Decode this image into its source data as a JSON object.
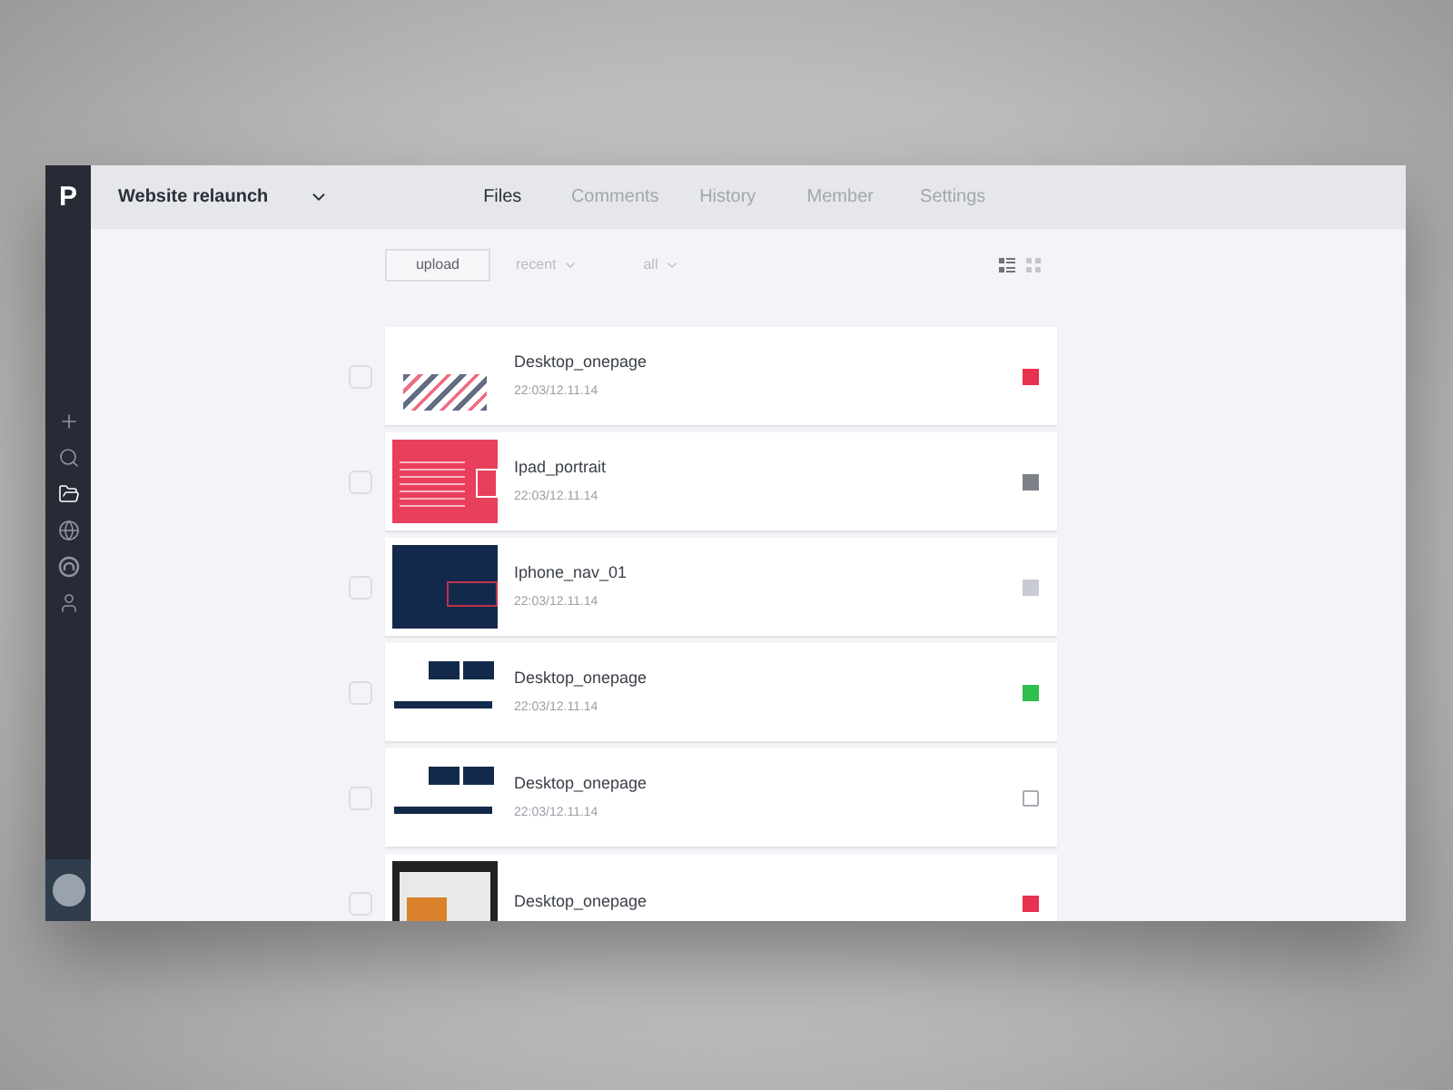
{
  "logo": "P",
  "sidebar": {
    "items": [
      {
        "kind": "plus",
        "selected": false
      },
      {
        "kind": "search",
        "selected": false
      },
      {
        "kind": "folder",
        "selected": true
      },
      {
        "kind": "globe",
        "selected": false
      },
      {
        "kind": "arch",
        "selected": false
      },
      {
        "kind": "user",
        "selected": false
      }
    ]
  },
  "project": {
    "title": "Website relaunch"
  },
  "tabs": [
    {
      "label": "Files",
      "selected": true
    },
    {
      "label": "Comments",
      "selected": false
    },
    {
      "label": "History",
      "selected": false
    },
    {
      "label": "Member",
      "selected": false
    },
    {
      "label": "Settings",
      "selected": false
    }
  ],
  "toolbar": {
    "upload": "upload",
    "filters": [
      "recent",
      "all"
    ],
    "views": [
      {
        "kind": "list",
        "selected": true
      },
      {
        "kind": "grid",
        "selected": false
      }
    ]
  },
  "files": [
    {
      "name": "Desktop_onepage",
      "time": "22:03/12.11.14",
      "kind": "illustration",
      "checked": false,
      "color": "#e8304f"
    },
    {
      "name": "Ipad_portrait",
      "time": "22:03/12.11.14",
      "kind": "red",
      "checked": false,
      "color": "#7d8187"
    },
    {
      "name": "Iphone_nav_01",
      "time": "22:03/12.11.14",
      "kind": "navy",
      "checked": false,
      "color": "#c8cbd2"
    },
    {
      "name": "Desktop_onepage",
      "time": "22:03/12.11.14",
      "kind": "layout",
      "checked": false,
      "color": "#2fbf4f"
    },
    {
      "name": "Desktop_onepage",
      "time": "22:03/12.11.14",
      "kind": "layout",
      "checked": false
    },
    {
      "name": "Desktop_onepage",
      "kind": "photo",
      "checked": false,
      "color": "#e8304f"
    }
  ]
}
